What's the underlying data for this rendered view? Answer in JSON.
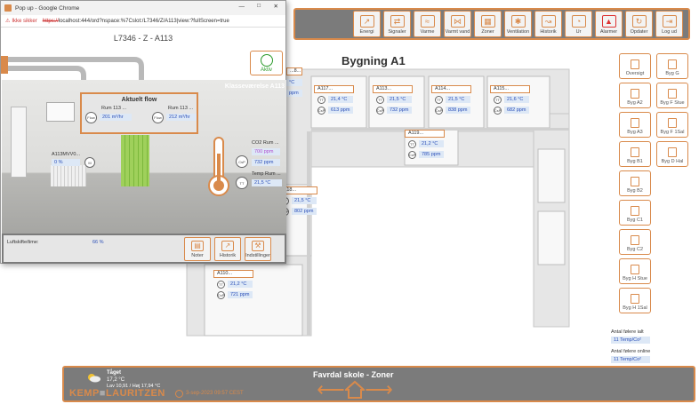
{
  "toolbar": {
    "items": [
      "Energi",
      "Signaler",
      "Varme",
      "Varmt vand",
      "Zoner",
      "Ventilation",
      "Historik",
      "Ur",
      "Alarmer",
      "Opdater",
      "Log ud"
    ],
    "icons": [
      "chart-icon",
      "signals-icon",
      "heat-icon",
      "tap-icon",
      "zones-icon",
      "fan-icon",
      "history-icon",
      "clock-icon",
      "alarm-bell-icon",
      "refresh-icon",
      "logout-icon"
    ]
  },
  "plan": {
    "title": "Bygning A1",
    "rooms": [
      {
        "name": "A117...",
        "temp": "21,4 °C",
        "co2": "613 ppm"
      },
      {
        "name": "A113...",
        "temp": "21,5 °C",
        "co2": "732 ppm"
      },
      {
        "name": "A114...",
        "temp": "21,5 °C",
        "co2": "838 ppm"
      },
      {
        "name": "A115...",
        "temp": "21,6 °C",
        "co2": "682 ppm"
      },
      {
        "name": "A119...",
        "temp": "21,2 °C",
        "co2": "785 ppm"
      },
      {
        "name": "A118...",
        "temp": "21,5 °C",
        "co2": "802 ppm"
      },
      {
        "name": "A110...",
        "temp": "21,2 °C",
        "co2": "721 ppm"
      }
    ],
    "partial": {
      "a": "...8...",
      "b": "°C",
      "c": "ppm"
    }
  },
  "side": {
    "left": [
      "Oversigt",
      "Byg A2",
      "Byg A3",
      "Byg B1",
      "Byg B2",
      "Byg C1",
      "Byg C2",
      "Byg H Stue",
      "Byg H 1Sal"
    ],
    "right": [
      "Byg G",
      "Byg F Stue",
      "Byg F 1Sal",
      "Byg D Hal"
    ]
  },
  "counters": {
    "total_label": "Antal følere ialt",
    "total_value": "11 Temp/Co²",
    "online_label": "Antal følere online",
    "online_value": "11 Temp/Co²"
  },
  "bottom": {
    "title": "Favrdal skole - Zoner",
    "weather_title": "Tåget",
    "weather_temp": "17,2 °C",
    "weather_range": "Lav 10,91 / Høj 17,94 °C",
    "logo_a": "KEMP",
    "logo_b": "LAURITZEN",
    "datetime": "3-sep-2023 09:57 CEST"
  },
  "popup": {
    "window_title": "Pop up - Google Chrome",
    "insecure": "Ikke sikker",
    "url_prefix": "https://",
    "url_rest": "localhost:444/ord?nspace:%7Cslot:/L7346/Z/A113|view:?fullScreen=true",
    "heading": "L7346 - Z - A113",
    "aktiv": "Aktiv",
    "room_title": "Klasseværelse A113",
    "flow_title": "Aktuelt flow",
    "flow1_label": "Rum 113 ...",
    "flow1_value": "201 m³/hr",
    "flow2_label": "Rum 113 ...",
    "flow2_value": "212 m³/hr",
    "flow_tag": "Flow",
    "mvv_label": "A113MVV0...",
    "mvv_value": "0 %",
    "mvv_tag": "M",
    "co2_label": "CO2 Rum ...",
    "co2_value1": "700 ppm",
    "co2_value2": "732 ppm",
    "co2_tag": "CsP",
    "temp_label": "Temp Rum ...",
    "temp_value": "21,5 °C",
    "temp_tag": "TT",
    "luft_label": "Luftskifte/time:",
    "luft_value": "66 %",
    "buttons": [
      "Noter",
      "Historik",
      "Indstillinger"
    ]
  }
}
